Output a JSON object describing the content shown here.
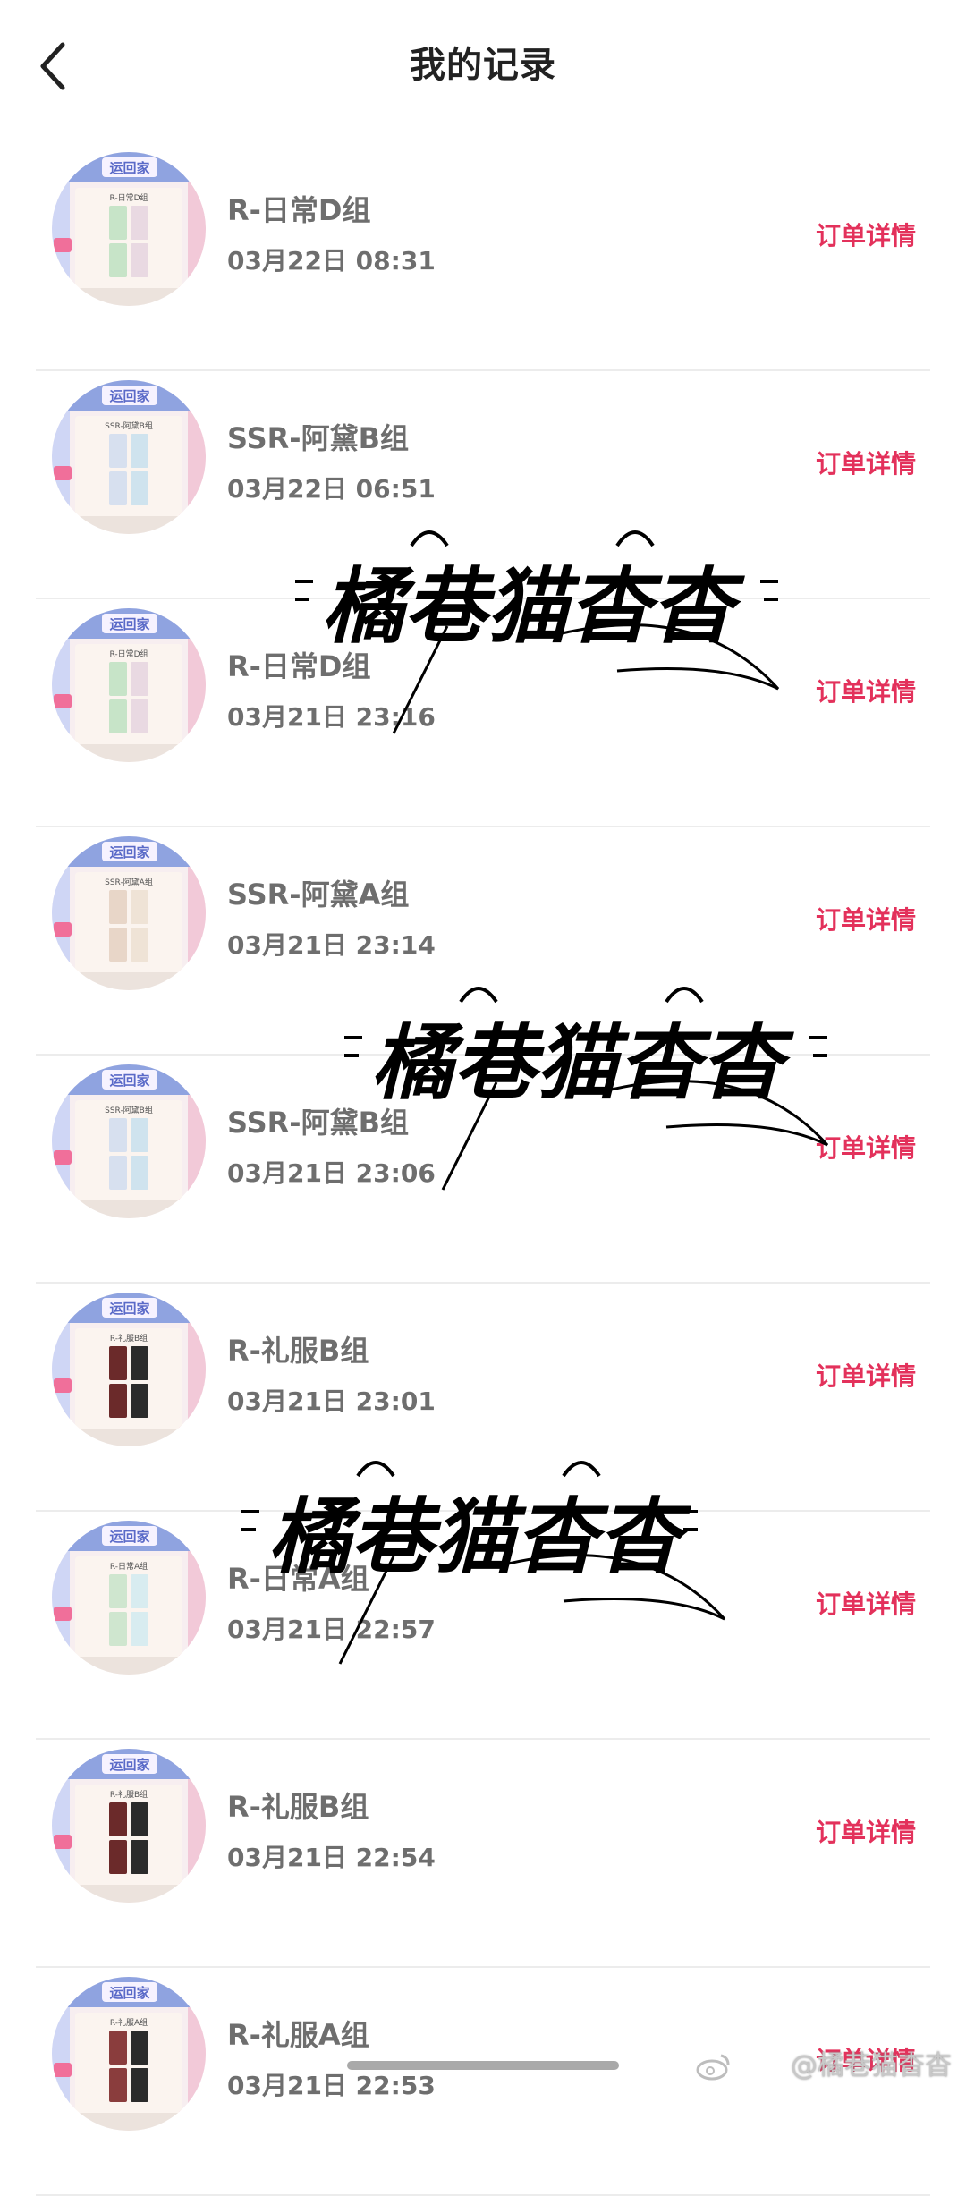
{
  "header": {
    "title": "我的记录"
  },
  "records": [
    {
      "title": "R-日常D组",
      "time": "03月22日  08:31",
      "detail": "订单详情",
      "thumb": {
        "banner": "运回家",
        "card_label": "R-日常D组",
        "cards": [
          "#c7e4c8",
          "#e9d9e2"
        ]
      }
    },
    {
      "title": "SSR-阿黛B组",
      "time": "03月22日  06:51",
      "detail": "订单详情",
      "thumb": {
        "banner": "运回家",
        "card_label": "SSR-阿黛B组",
        "cards": [
          "#d7e0ef",
          "#cfe3ee"
        ]
      }
    },
    {
      "title": "R-日常D组",
      "time": "03月21日  23:16",
      "detail": "订单详情",
      "thumb": {
        "banner": "运回家",
        "card_label": "R-日常D组",
        "cards": [
          "#c7e4c8",
          "#e9d9e2"
        ]
      }
    },
    {
      "title": "SSR-阿黛A组",
      "time": "03月21日  23:14",
      "detail": "订单详情",
      "thumb": {
        "banner": "运回家",
        "card_label": "SSR-阿黛A组",
        "cards": [
          "#e8d6c8",
          "#efe3d6"
        ]
      }
    },
    {
      "title": "SSR-阿黛B组",
      "time": "03月21日  23:06",
      "detail": "订单详情",
      "thumb": {
        "banner": "运回家",
        "card_label": "SSR-阿黛B组",
        "cards": [
          "#d7e0ef",
          "#cfe3ee"
        ]
      }
    },
    {
      "title": "R-礼服B组",
      "time": "03月21日  23:01",
      "detail": "订单详情",
      "thumb": {
        "banner": "运回家",
        "card_label": "R-礼服B组",
        "cards": [
          "#6b2a2a",
          "#2b2b2b"
        ]
      }
    },
    {
      "title": "R-日常A组",
      "time": "03月21日  22:57",
      "detail": "订单详情",
      "thumb": {
        "banner": "运回家",
        "card_label": "R-日常A组",
        "cards": [
          "#cfe6cf",
          "#d8ecf0"
        ]
      }
    },
    {
      "title": "R-礼服B组",
      "time": "03月21日  22:54",
      "detail": "订单详情",
      "thumb": {
        "banner": "运回家",
        "card_label": "R-礼服B组",
        "cards": [
          "#6b2a2a",
          "#2b2b2b"
        ]
      }
    },
    {
      "title": "R-礼服A组",
      "time": "03月21日  22:53",
      "detail": "订单详情",
      "thumb": {
        "banner": "运回家",
        "card_label": "R-礼服A组",
        "cards": [
          "#8a3d3d",
          "#2b2b2b"
        ]
      }
    }
  ],
  "watermark": {
    "text": "橘巷猫杳杳"
  },
  "corner_watermark": "@橘巷猫杳杳",
  "colors": {
    "accent": "#e3315b",
    "text_muted": "#6e6e6e",
    "divider": "#ececec"
  },
  "icons": {
    "back": "chevron-left-icon",
    "weibo": "weibo-icon"
  }
}
